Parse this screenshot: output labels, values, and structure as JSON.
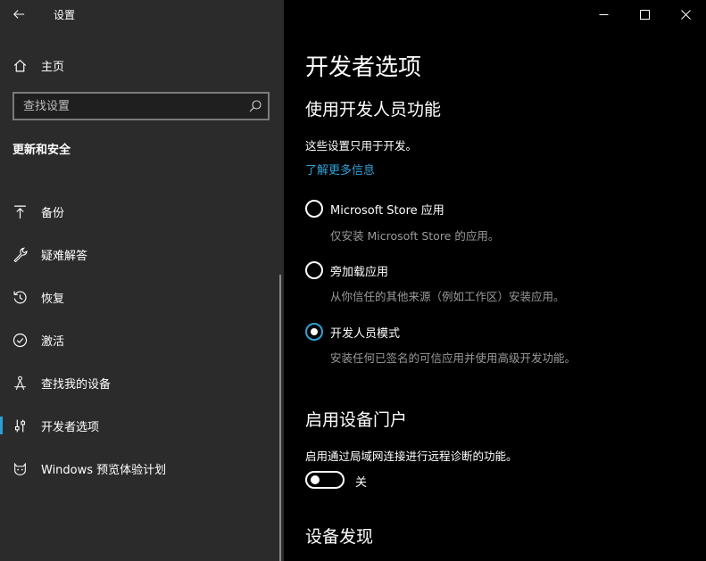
{
  "window": {
    "title": "设置"
  },
  "sidebar": {
    "home_label": "主页",
    "search_placeholder": "查找设置",
    "section_title": "更新和安全",
    "items": [
      {
        "label": "备份",
        "icon": "backup-arrow-icon"
      },
      {
        "label": "疑难解答",
        "icon": "wrench-icon"
      },
      {
        "label": "恢复",
        "icon": "recovery-icon"
      },
      {
        "label": "激活",
        "icon": "activation-check-icon"
      },
      {
        "label": "查找我的设备",
        "icon": "find-device-icon"
      },
      {
        "label": "开发者选项",
        "icon": "developer-sliders-icon",
        "active": true
      },
      {
        "label": "Windows 预览体验计划",
        "icon": "insider-cat-icon"
      }
    ]
  },
  "main": {
    "page_title": "开发者选项",
    "dev_features": {
      "heading": "使用开发人员功能",
      "description": "这些设置只用于开发。",
      "learn_more": "了解更多信息",
      "options": [
        {
          "label": "Microsoft Store 应用",
          "description": "仅安装 Microsoft Store 的应用。",
          "checked": false
        },
        {
          "label": "旁加载应用",
          "description": "从你信任的其他来源（例如工作区）安装应用。",
          "checked": false
        },
        {
          "label": "开发人员模式",
          "description": "安装任何已签名的可信应用并使用高级开发功能。",
          "checked": true
        }
      ]
    },
    "device_portal": {
      "heading": "启用设备门户",
      "description": "启用通过局域网连接进行远程诊断的功能。",
      "toggle_state": "关",
      "toggle_on": false
    },
    "device_discovery": {
      "heading": "设备发现"
    }
  },
  "colors": {
    "accent": "#2aa3d8",
    "sidebar_bg": "#2b2b2b",
    "main_bg": "#000000"
  }
}
